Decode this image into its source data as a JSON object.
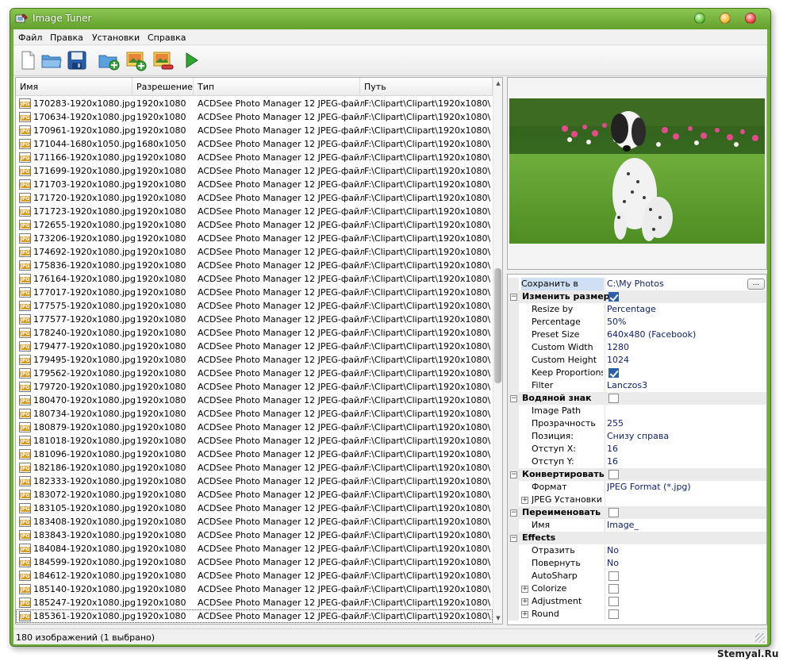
{
  "window": {
    "title": "Image Tuner"
  },
  "menu": [
    "Файл",
    "Правка",
    "Установки",
    "Справка"
  ],
  "toolbar": [
    {
      "icon": "new-file-icon"
    },
    {
      "icon": "open-folder-icon"
    },
    {
      "icon": "save-icon"
    },
    {
      "icon": "add-folder-icon"
    },
    {
      "icon": "add-image-icon"
    },
    {
      "icon": "remove-image-icon"
    },
    {
      "icon": "play-icon"
    }
  ],
  "list": {
    "columns": [
      "Имя",
      "Разрешение",
      "Тип",
      "Путь"
    ],
    "rows": [
      [
        "170283-1920x1080.jpg",
        "1920x1080",
        "ACDSee Photo Manager 12 JPEG-файл",
        "F:\\Clipart\\Clipart\\1920x1080\\"
      ],
      [
        "170634-1920x1080.jpg",
        "1920x1080",
        "ACDSee Photo Manager 12 JPEG-файл",
        "F:\\Clipart\\Clipart\\1920x1080\\"
      ],
      [
        "170961-1920x1080.jpg",
        "1920x1080",
        "ACDSee Photo Manager 12 JPEG-файл",
        "F:\\Clipart\\Clipart\\1920x1080\\"
      ],
      [
        "171044-1680x1050.jpg",
        "1680x1050",
        "ACDSee Photo Manager 12 JPEG-файл",
        "F:\\Clipart\\Clipart\\1920x1080\\"
      ],
      [
        "171166-1920x1080.jpg",
        "1920x1080",
        "ACDSee Photo Manager 12 JPEG-файл",
        "F:\\Clipart\\Clipart\\1920x1080\\"
      ],
      [
        "171699-1920x1080.jpg",
        "1920x1080",
        "ACDSee Photo Manager 12 JPEG-файл",
        "F:\\Clipart\\Clipart\\1920x1080\\"
      ],
      [
        "171703-1920x1080.jpg",
        "1920x1080",
        "ACDSee Photo Manager 12 JPEG-файл",
        "F:\\Clipart\\Clipart\\1920x1080\\"
      ],
      [
        "171720-1920x1080.jpg",
        "1920x1080",
        "ACDSee Photo Manager 12 JPEG-файл",
        "F:\\Clipart\\Clipart\\1920x1080\\"
      ],
      [
        "171723-1920x1080.jpg",
        "1920x1080",
        "ACDSee Photo Manager 12 JPEG-файл",
        "F:\\Clipart\\Clipart\\1920x1080\\"
      ],
      [
        "172655-1920x1080.jpg",
        "1920x1080",
        "ACDSee Photo Manager 12 JPEG-файл",
        "F:\\Clipart\\Clipart\\1920x1080\\"
      ],
      [
        "173206-1920x1080.jpg",
        "1920x1080",
        "ACDSee Photo Manager 12 JPEG-файл",
        "F:\\Clipart\\Clipart\\1920x1080\\"
      ],
      [
        "174692-1920x1080.jpg",
        "1920x1080",
        "ACDSee Photo Manager 12 JPEG-файл",
        "F:\\Clipart\\Clipart\\1920x1080\\"
      ],
      [
        "175836-1920x1080.jpg",
        "1920x1080",
        "ACDSee Photo Manager 12 JPEG-файл",
        "F:\\Clipart\\Clipart\\1920x1080\\"
      ],
      [
        "176164-1920x1080.jpg",
        "1920x1080",
        "ACDSee Photo Manager 12 JPEG-файл",
        "F:\\Clipart\\Clipart\\1920x1080\\"
      ],
      [
        "177017-1920x1080.jpg",
        "1920x1080",
        "ACDSee Photo Manager 12 JPEG-файл",
        "F:\\Clipart\\Clipart\\1920x1080\\"
      ],
      [
        "177575-1920x1080.jpg",
        "1920x1080",
        "ACDSee Photo Manager 12 JPEG-файл",
        "F:\\Clipart\\Clipart\\1920x1080\\"
      ],
      [
        "177577-1920x1080.jpg",
        "1920x1080",
        "ACDSee Photo Manager 12 JPEG-файл",
        "F:\\Clipart\\Clipart\\1920x1080\\"
      ],
      [
        "178240-1920x1080.jpg",
        "1920x1080",
        "ACDSee Photo Manager 12 JPEG-файл",
        "F:\\Clipart\\Clipart\\1920x1080\\"
      ],
      [
        "179477-1920x1080.jpg",
        "1920x1080",
        "ACDSee Photo Manager 12 JPEG-файл",
        "F:\\Clipart\\Clipart\\1920x1080\\"
      ],
      [
        "179495-1920x1080.jpg",
        "1920x1080",
        "ACDSee Photo Manager 12 JPEG-файл",
        "F:\\Clipart\\Clipart\\1920x1080\\"
      ],
      [
        "179562-1920x1080.jpg",
        "1920x1080",
        "ACDSee Photo Manager 12 JPEG-файл",
        "F:\\Clipart\\Clipart\\1920x1080\\"
      ],
      [
        "179720-1920x1080.jpg",
        "1920x1080",
        "ACDSee Photo Manager 12 JPEG-файл",
        "F:\\Clipart\\Clipart\\1920x1080\\"
      ],
      [
        "180470-1920x1080.jpg",
        "1920x1080",
        "ACDSee Photo Manager 12 JPEG-файл",
        "F:\\Clipart\\Clipart\\1920x1080\\"
      ],
      [
        "180734-1920x1080.jpg",
        "1920x1080",
        "ACDSee Photo Manager 12 JPEG-файл",
        "F:\\Clipart\\Clipart\\1920x1080\\"
      ],
      [
        "180879-1920x1080.jpg",
        "1920x1080",
        "ACDSee Photo Manager 12 JPEG-файл",
        "F:\\Clipart\\Clipart\\1920x1080\\"
      ],
      [
        "181018-1920x1080.jpg",
        "1920x1080",
        "ACDSee Photo Manager 12 JPEG-файл",
        "F:\\Clipart\\Clipart\\1920x1080\\"
      ],
      [
        "181096-1920x1080.jpg",
        "1920x1080",
        "ACDSee Photo Manager 12 JPEG-файл",
        "F:\\Clipart\\Clipart\\1920x1080\\"
      ],
      [
        "182186-1920x1080.jpg",
        "1920x1080",
        "ACDSee Photo Manager 12 JPEG-файл",
        "F:\\Clipart\\Clipart\\1920x1080\\"
      ],
      [
        "182333-1920x1080.jpg",
        "1920x1080",
        "ACDSee Photo Manager 12 JPEG-файл",
        "F:\\Clipart\\Clipart\\1920x1080\\"
      ],
      [
        "183072-1920x1080.jpg",
        "1920x1080",
        "ACDSee Photo Manager 12 JPEG-файл",
        "F:\\Clipart\\Clipart\\1920x1080\\"
      ],
      [
        "183105-1920x1080.jpg",
        "1920x1080",
        "ACDSee Photo Manager 12 JPEG-файл",
        "F:\\Clipart\\Clipart\\1920x1080\\"
      ],
      [
        "183408-1920x1080.jpg",
        "1920x1080",
        "ACDSee Photo Manager 12 JPEG-файл",
        "F:\\Clipart\\Clipart\\1920x1080\\"
      ],
      [
        "183843-1920x1080.jpg",
        "1920x1080",
        "ACDSee Photo Manager 12 JPEG-файл",
        "F:\\Clipart\\Clipart\\1920x1080\\"
      ],
      [
        "184084-1920x1080.jpg",
        "1920x1080",
        "ACDSee Photo Manager 12 JPEG-файл",
        "F:\\Clipart\\Clipart\\1920x1080\\"
      ],
      [
        "184599-1920x1080.jpg",
        "1920x1080",
        "ACDSee Photo Manager 12 JPEG-файл",
        "F:\\Clipart\\Clipart\\1920x1080\\"
      ],
      [
        "184612-1920x1080.jpg",
        "1920x1080",
        "ACDSee Photo Manager 12 JPEG-файл",
        "F:\\Clipart\\Clipart\\1920x1080\\"
      ],
      [
        "185140-1920x1080.jpg",
        "1920x1080",
        "ACDSee Photo Manager 12 JPEG-файл",
        "F:\\Clipart\\Clipart\\1920x1080\\"
      ],
      [
        "185247-1920x1080.jpg",
        "1920x1080",
        "ACDSee Photo Manager 12 JPEG-файл",
        "F:\\Clipart\\Clipart\\1920x1080\\"
      ],
      [
        "185361-1920x1080.jpg",
        "1920x1080",
        "ACDSee Photo Manager 12 JPEG-файл",
        "F:\\Clipart\\Clipart\\1920x1080\\"
      ]
    ],
    "icon_label": "JPG"
  },
  "properties": [
    {
      "kind": "top",
      "name": "Сохранить в",
      "value": "C:\\My Photos",
      "browse": "..."
    },
    {
      "kind": "cat",
      "name": "Изменить размер",
      "check": true
    },
    {
      "kind": "prop",
      "name": "Resize by",
      "value": "Percentage"
    },
    {
      "kind": "prop",
      "name": "Percentage",
      "value": "50%"
    },
    {
      "kind": "prop",
      "name": "Preset Size",
      "value": "640x480 (Facebook)"
    },
    {
      "kind": "prop",
      "name": "Custom Width",
      "value": "1280"
    },
    {
      "kind": "prop",
      "name": "Custom Height",
      "value": "1024"
    },
    {
      "kind": "prop",
      "name": "Keep Proportions",
      "check": true
    },
    {
      "kind": "prop",
      "name": "Filter",
      "value": "Lanczos3"
    },
    {
      "kind": "cat",
      "name": "Водяной знак",
      "check": false
    },
    {
      "kind": "prop",
      "name": "Image Path",
      "value": ""
    },
    {
      "kind": "prop",
      "name": "Прозрачность",
      "value": "255"
    },
    {
      "kind": "prop",
      "name": "Позиция:",
      "value": "Снизу справа"
    },
    {
      "kind": "prop",
      "name": "Отступ X:",
      "value": "16"
    },
    {
      "kind": "prop",
      "name": "Отступ Y:",
      "value": "16"
    },
    {
      "kind": "cat",
      "name": "Конвертировать",
      "check": false
    },
    {
      "kind": "prop",
      "name": "Формат",
      "value": "JPEG Format (*.jpg)"
    },
    {
      "kind": "sub",
      "name": "JPEG Установки",
      "value": ""
    },
    {
      "kind": "cat",
      "name": "Переименовать",
      "check": false
    },
    {
      "kind": "prop",
      "name": "Имя",
      "value": "Image_"
    },
    {
      "kind": "cat",
      "name": "Effects"
    },
    {
      "kind": "prop",
      "name": "Отразить",
      "value": "No"
    },
    {
      "kind": "prop",
      "name": "Повернуть",
      "value": "No"
    },
    {
      "kind": "prop",
      "name": "AutoSharp",
      "check": false
    },
    {
      "kind": "sub",
      "name": "Colorize",
      "check": false
    },
    {
      "kind": "sub",
      "name": "Adjustment",
      "check": false
    },
    {
      "kind": "sub",
      "name": "Round",
      "check": false
    }
  ],
  "status": {
    "text": "180 изображений (1 выбрано)"
  },
  "watermark": "Stemyal.Ru",
  "colors": {
    "titlebar": "#6fae38",
    "value_text": "#11216d",
    "selection": "#cfe0f5"
  }
}
